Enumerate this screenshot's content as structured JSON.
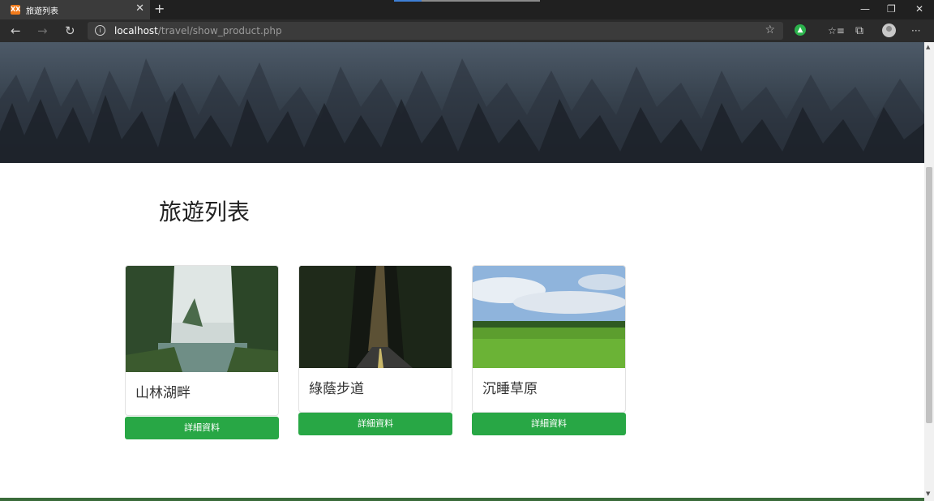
{
  "browser": {
    "tab_title": "旅遊列表",
    "tab_favicon_text": "XX",
    "url_host": "localhost",
    "url_path": "/travel/show_product.php",
    "new_tab_glyph": "+",
    "close_glyph": "✕",
    "minimize_glyph": "—",
    "restore_glyph": "❐",
    "window_close_glyph": "✕",
    "back_glyph": "←",
    "forward_glyph": "→",
    "refresh_glyph": "↻",
    "star_glyph": "☆",
    "favorites_glyph": "☆≡",
    "collections_glyph": "⧉",
    "more_glyph": "···",
    "info_glyph": "i",
    "extension_glyph": "👍"
  },
  "page": {
    "title": "旅遊列表"
  },
  "products": [
    {
      "name": "山林湖畔",
      "button_label": "詳細資料"
    },
    {
      "name": "綠蔭步道",
      "button_label": "詳細資料"
    },
    {
      "name": "沉睡草原",
      "button_label": "詳細資料"
    }
  ],
  "colors": {
    "button_green": "#28a745",
    "browser_dark": "#202020",
    "hero_fog": "#4d5a68"
  },
  "icons": [
    "info-icon",
    "star-icon",
    "extension-icon",
    "favorites-icon",
    "collections-icon",
    "avatar",
    "more-icon"
  ]
}
